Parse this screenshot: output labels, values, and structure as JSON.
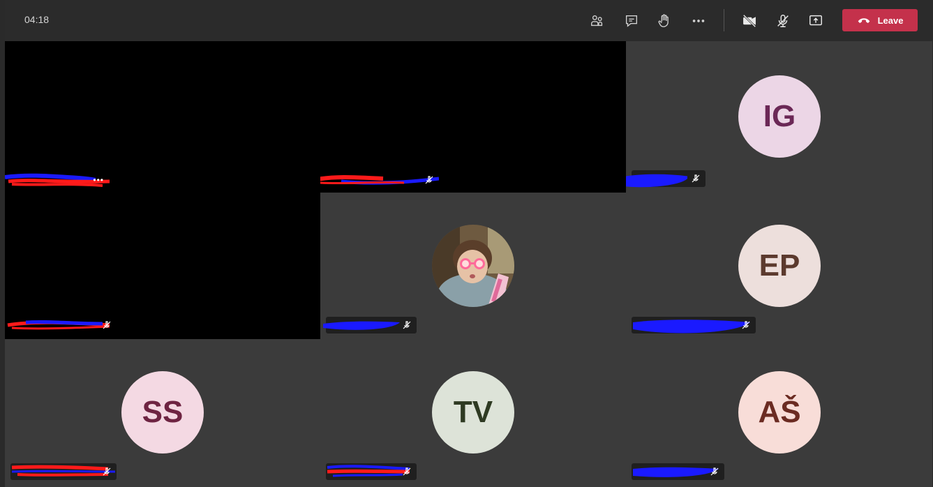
{
  "meeting": {
    "timer": "04:18"
  },
  "toolbar": {
    "people_icon": "people-icon",
    "chat_icon": "chat-icon",
    "raise_hand_icon": "raise-hand-icon",
    "more_icon": "more-icon",
    "camera_off_icon": "camera-off-icon",
    "mic_off_icon": "mic-off-icon",
    "share_icon": "share-screen-icon",
    "leave_label": "Leave",
    "leave_color": "#c4314b"
  },
  "participants": [
    {
      "initials": "",
      "video": "off-black"
    },
    {
      "initials": "",
      "video": "off-black"
    },
    {
      "initials": "IG",
      "bg": "#ecd6e6",
      "fg": "#6b2856"
    },
    {
      "initials": "",
      "video": "off-black"
    },
    {
      "initials": "",
      "video": "photo"
    },
    {
      "initials": "EP",
      "bg": "#eddfdc",
      "fg": "#5c3a2e"
    },
    {
      "initials": "SS",
      "bg": "#f4d9e3",
      "fg": "#6e2442"
    },
    {
      "initials": "TV",
      "bg": "#dde3d8",
      "fg": "#2e3a22"
    },
    {
      "initials": "AŠ",
      "bg": "#f8ddd8",
      "fg": "#6b2b22"
    }
  ]
}
